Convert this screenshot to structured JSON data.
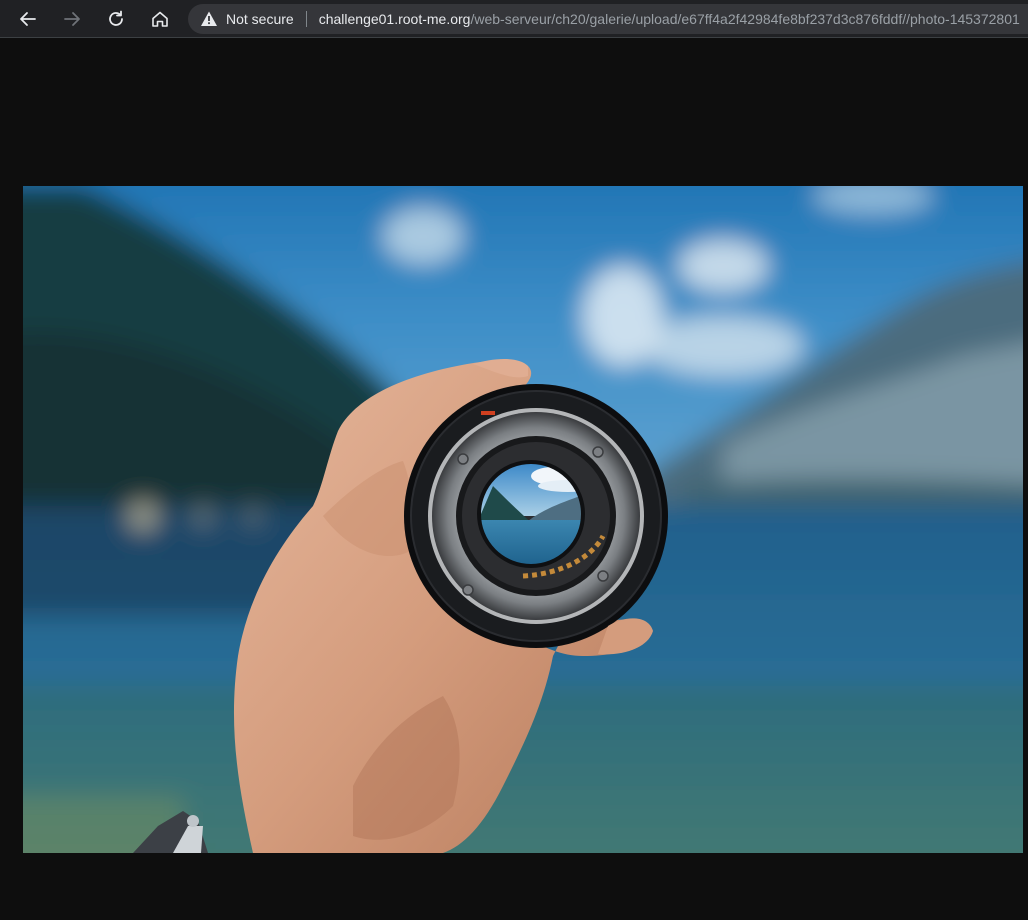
{
  "browser": {
    "security_label": "Not secure",
    "url_host": "challenge01.root-me.org",
    "url_path": "/web-serveur/ch20/galerie/upload/e67ff4a2f42984fe8bf237d3c876fddf//photo-145372801"
  },
  "icons": {
    "back": "arrow-left-icon",
    "forward": "arrow-right-icon",
    "reload": "reload-icon",
    "home": "home-icon",
    "warning": "warning-triangle-icon"
  },
  "colors": {
    "page_background": "#0e0e0e",
    "toolbar_background": "#202124",
    "address_bar_background": "#35363a"
  }
}
